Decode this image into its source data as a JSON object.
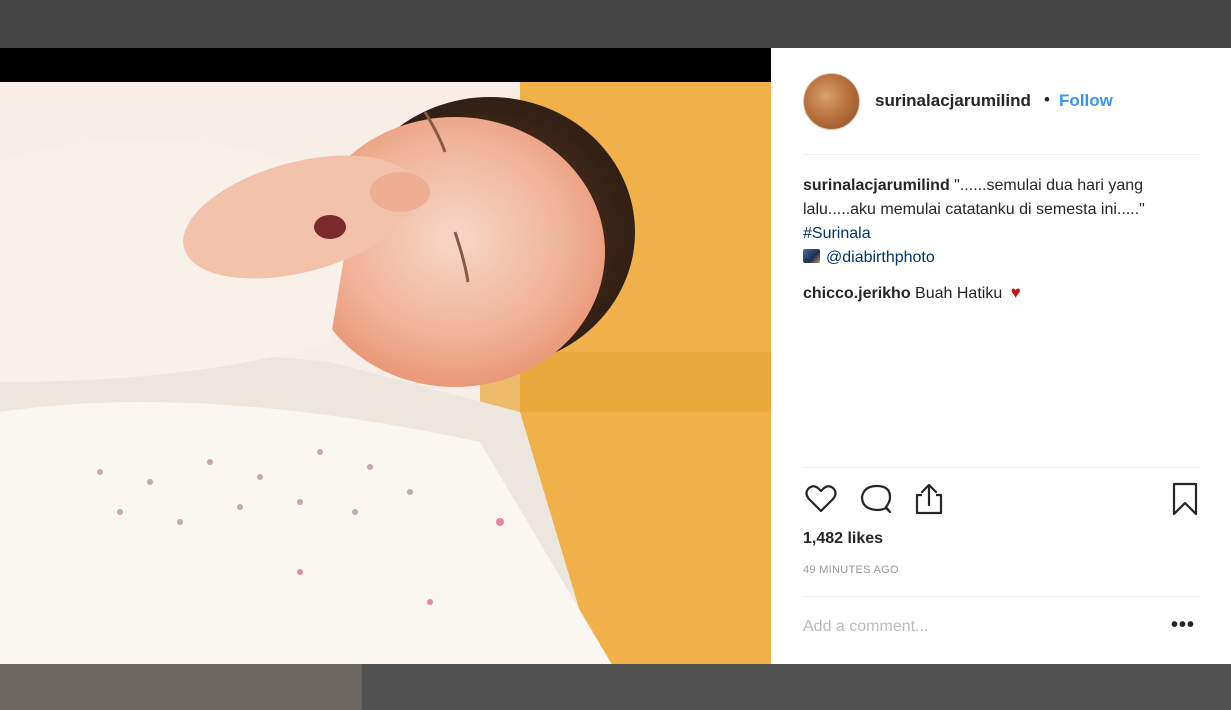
{
  "post": {
    "username": "surinalacjarumilind",
    "separator": "•",
    "follow_label": "Follow",
    "caption_text": "\"......semulai dua hari yang lalu.....aku memulai catatanku di semesta ini.....\"",
    "hashtag": "#Surinala",
    "photo_credit": "@diabirthphoto",
    "comment_user": "chicco.jerikho",
    "comment_text": "Buah Hatiku",
    "comment_emoji": "♥",
    "likes": "1,482 likes",
    "time": "49 MINUTES AGO",
    "add_comment_placeholder": "Add a comment...",
    "more_label": "•••"
  },
  "icons": {
    "like": "heart-outline-icon",
    "comment": "speech-bubble-icon",
    "share": "share-icon",
    "save": "bookmark-icon"
  },
  "colors": {
    "follow": "#3897f0",
    "text": "#262626",
    "heart": "#c4161c"
  }
}
